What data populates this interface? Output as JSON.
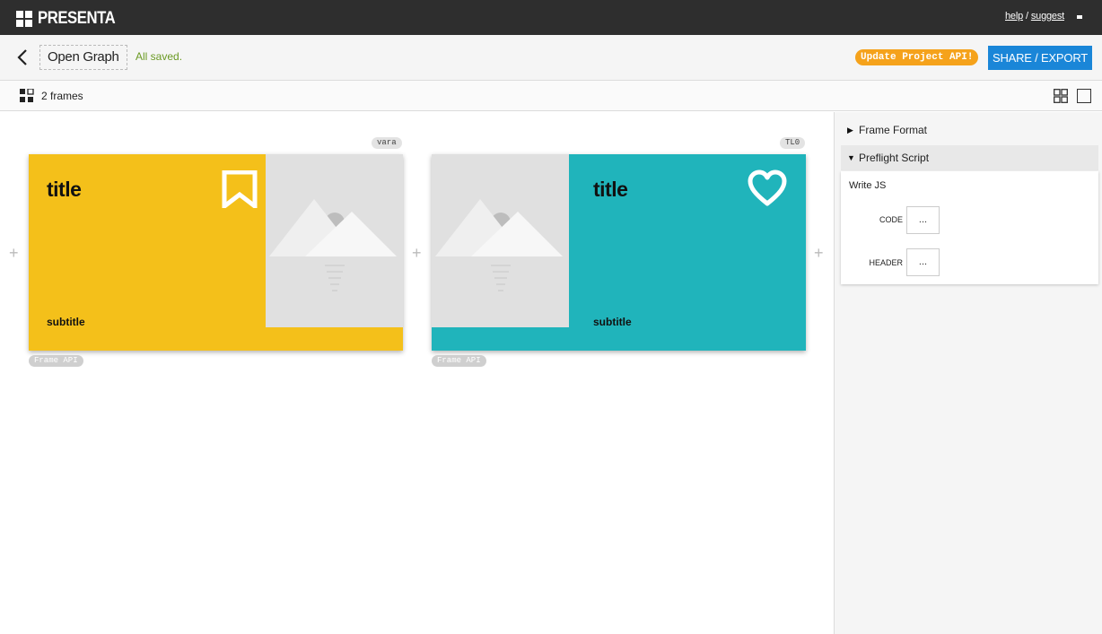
{
  "app": {
    "logo_text": "PRESENTA",
    "links": {
      "help": "help",
      "separator": "/",
      "suggest": "suggest"
    }
  },
  "project": {
    "name": "Open Graph",
    "status": "All saved.",
    "update_api_label": "Update Project API!",
    "share_label": "SHARE / EXPORT"
  },
  "frames_bar": {
    "count_label": "2 frames"
  },
  "frames": [
    {
      "tag": "vara",
      "title": "title",
      "subtitle": "subtitle",
      "api_label": "Frame API",
      "background": "#F4C01A",
      "icon": "bookmark-icon"
    },
    {
      "tag": "TL0",
      "title": "title",
      "subtitle": "subtitle",
      "api_label": "Frame API",
      "background": "#20B4BB",
      "icon": "heart-icon"
    }
  ],
  "panel": {
    "frame_format": "Frame Format",
    "preflight_script": "Preflight Script",
    "write_js": "Write JS",
    "fields": [
      {
        "label": "CODE",
        "value": "..."
      },
      {
        "label": "HEADER",
        "value": "..."
      }
    ]
  },
  "colors": {
    "topbar": "#2E2E2E",
    "accent_blue": "#1A86D8",
    "accent_orange": "#F5A21B",
    "saved_green": "#6B9A24"
  },
  "add_symbol": "+"
}
